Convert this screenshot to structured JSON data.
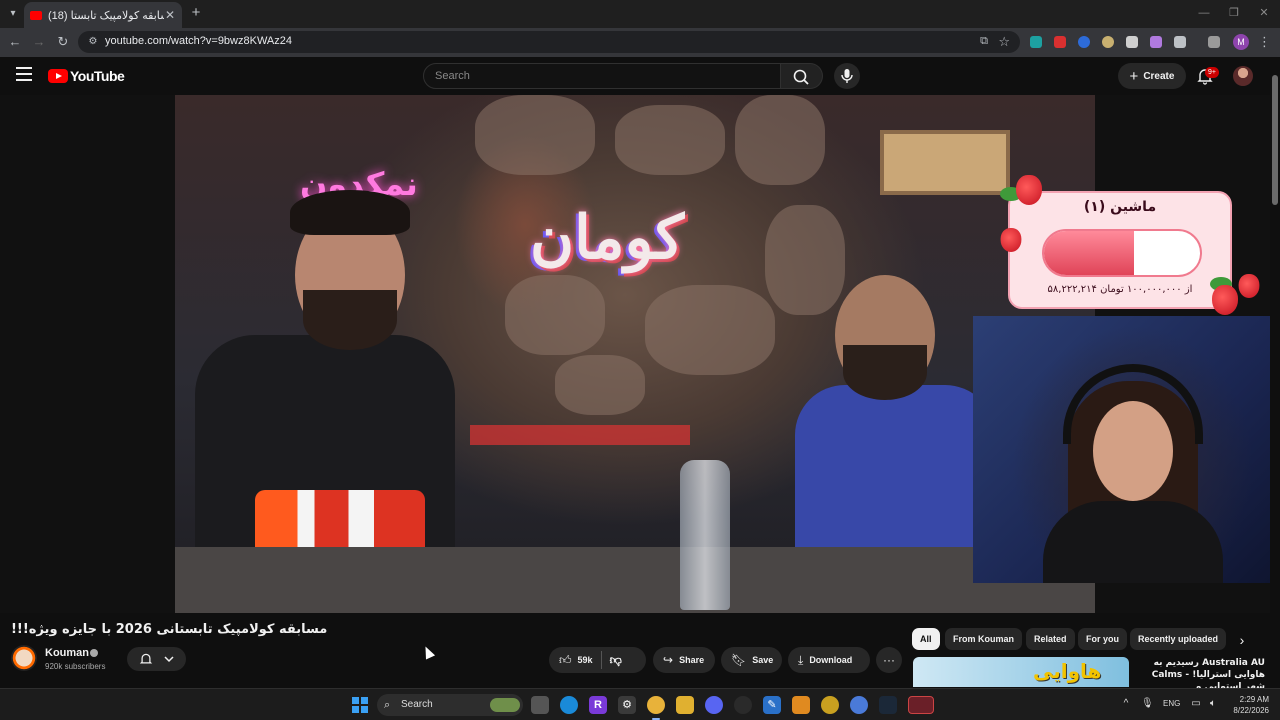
{
  "browser": {
    "tab_title": "(18) مسابقه کولامپیک تابستا",
    "tab_close": "✕",
    "new_tab": "+",
    "url": "youtube.com/watch?v=9bwz8KWAz24",
    "window_controls": [
      "—",
      "❐",
      "✕"
    ],
    "profile_initial": "M",
    "colors": {
      "tab_bg": "#35363a",
      "frame_bg": "#1f1f1f"
    }
  },
  "youtube": {
    "logo_text": "YouTube",
    "search_placeholder": "Search",
    "create_label": "Create",
    "notification_count": "9+",
    "brand_color": "#ff0000"
  },
  "video": {
    "title": "!!!مسابقه کولامپیک تابستانی 2026 با جایزه ویژه",
    "channel_name": "Kouman",
    "subscribers": "920k subscribers",
    "likes": "59k",
    "actions": {
      "share": "Share",
      "save": "Save",
      "download": "Download",
      "more": "···"
    },
    "scene_signs": {
      "neon": "کومان",
      "pink": "نمکدون"
    }
  },
  "overlay": {
    "donation_title": "ماشین (۱)",
    "donation_amount": "۵۸,۲۲۲,۲۱۴ از ۱۰۰,۰۰۰,۰۰۰ تومان",
    "progress_fraction": 0.58
  },
  "chips": [
    "All",
    "From Kouman",
    "Related",
    "For you",
    "Recently uploaded"
  ],
  "recommendation": {
    "thumb_text": "هاوایی",
    "title": "رسیدیم به Australia AU Calms - هاوایی استرالیا! شهر استوایی و"
  },
  "taskbar": {
    "search_label": "Search",
    "language": "ENG",
    "time": "2:29 AM",
    "date": "8/22/2026"
  }
}
